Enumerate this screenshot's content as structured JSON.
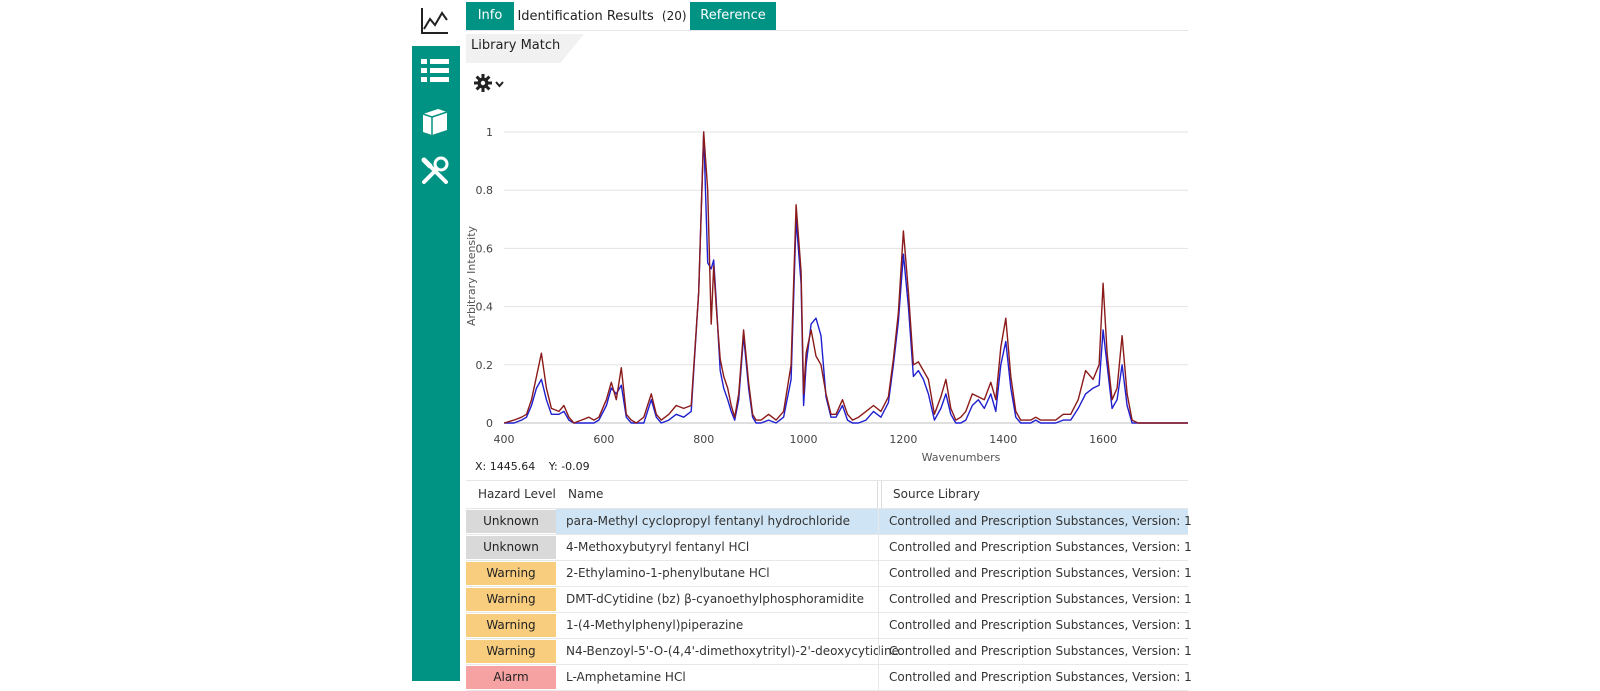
{
  "tabs": [
    {
      "label": "Info",
      "active": false
    },
    {
      "label": "Identification Results",
      "count": "(20)",
      "active": true
    },
    {
      "label": "Reference",
      "active": false
    }
  ],
  "subtab": {
    "label": "Library Match"
  },
  "sidebar": {
    "items": [
      {
        "icon": "spectrum-chart-icon"
      },
      {
        "icon": "list-icon"
      },
      {
        "icon": "book-icon"
      },
      {
        "icon": "tools-icon"
      }
    ]
  },
  "cursor": {
    "x": "X: 1445.64",
    "y": "Y: -0.09"
  },
  "colors": {
    "accent": "#009384",
    "series_blue": "#1f1fd0",
    "series_red": "#8b1a1a",
    "unknown": "#d9d9d9",
    "warning": "#f8cd7e",
    "alarm": "#f7a2a2",
    "selected": "#cfe4f4"
  },
  "table": {
    "headers": {
      "hazard": "Hazard Level",
      "name": "Name",
      "source": "Source Library"
    },
    "rows": [
      {
        "hazard": "Unknown",
        "level": "unknown",
        "name": "para-Methyl cyclopropyl fentanyl hydrochloride",
        "source": "Controlled and Prescription Substances, Version: 1",
        "selected": true
      },
      {
        "hazard": "Unknown",
        "level": "unknown",
        "name": "4-Methoxybutyryl fentanyl HCl",
        "source": "Controlled and Prescription Substances, Version: 1",
        "selected": false
      },
      {
        "hazard": "Warning",
        "level": "warning",
        "name": "2-Ethylamino-1-phenylbutane HCl",
        "source": "Controlled and Prescription Substances, Version: 1",
        "selected": false
      },
      {
        "hazard": "Warning",
        "level": "warning",
        "name": "DMT-dCytidine (bz)  β-cyanoethylphosphoramidite",
        "source": "Controlled and Prescription Substances, Version: 1",
        "selected": false
      },
      {
        "hazard": "Warning",
        "level": "warning",
        "name": "1-(4-Methylphenyl)piperazine",
        "source": "Controlled and Prescription Substances, Version: 1",
        "selected": false
      },
      {
        "hazard": "Warning",
        "level": "warning",
        "name": "N4-Benzoyl-5'-O-(4,4'-dimethoxytrityl)-2'-deoxycytidine",
        "source": "Controlled and Prescription Substances, Version: 1",
        "selected": false
      },
      {
        "hazard": "Alarm",
        "level": "alarm",
        "name": "L-Amphetamine HCl",
        "source": "Controlled and Prescription Substances, Version: 1",
        "selected": false
      }
    ]
  },
  "chart_data": {
    "type": "line",
    "xlabel": "Wavenumbers",
    "ylabel": "Arbitrary Intensity",
    "xlim": [
      400,
      1770
    ],
    "ylim": [
      0,
      1
    ],
    "xticks": [
      400,
      600,
      800,
      1000,
      1200,
      1400,
      1600
    ],
    "yticks": [
      0,
      0.2,
      0.4,
      0.6,
      0.8,
      1
    ],
    "yticklabels": [
      "0",
      "0.2",
      "0.4",
      "0.6",
      "0.8",
      "1"
    ],
    "grid": true,
    "series": [
      {
        "color": "#1f1fd0",
        "x": [
          400,
          420,
          435,
          445,
          455,
          465,
          475,
          485,
          495,
          510,
          520,
          530,
          540,
          555,
          570,
          580,
          590,
          605,
          615,
          625,
          635,
          645,
          655,
          665,
          680,
          695,
          705,
          715,
          730,
          745,
          760,
          775,
          790,
          800,
          808,
          815,
          820,
          825,
          833,
          840,
          848,
          855,
          862,
          870,
          880,
          890,
          898,
          905,
          915,
          930,
          945,
          960,
          975,
          985,
          995,
          1000,
          1005,
          1015,
          1025,
          1035,
          1045,
          1055,
          1065,
          1078,
          1088,
          1098,
          1110,
          1125,
          1140,
          1155,
          1170,
          1180,
          1190,
          1200,
          1210,
          1220,
          1230,
          1240,
          1250,
          1262,
          1275,
          1285,
          1295,
          1305,
          1315,
          1325,
          1338,
          1350,
          1362,
          1375,
          1385,
          1395,
          1405,
          1415,
          1425,
          1435,
          1445,
          1455,
          1465,
          1475,
          1490,
          1505,
          1520,
          1535,
          1550,
          1565,
          1580,
          1592,
          1600,
          1608,
          1618,
          1628,
          1638,
          1648,
          1658,
          1670,
          1690,
          1720,
          1770
        ],
        "y": [
          0,
          0,
          0.01,
          0.02,
          0.06,
          0.12,
          0.15,
          0.08,
          0.03,
          0.03,
          0.04,
          0.01,
          0,
          0,
          0,
          0,
          0.01,
          0.06,
          0.12,
          0.1,
          0.13,
          0.02,
          0,
          0,
          0,
          0.08,
          0.02,
          0,
          0.01,
          0.03,
          0.02,
          0.04,
          0.45,
          1.0,
          0.55,
          0.53,
          0.56,
          0.42,
          0.18,
          0.12,
          0.08,
          0.04,
          0.01,
          0.08,
          0.3,
          0.12,
          0.02,
          0,
          0,
          0.01,
          0,
          0.02,
          0.15,
          0.7,
          0.48,
          0.06,
          0.2,
          0.34,
          0.36,
          0.3,
          0.09,
          0.02,
          0.02,
          0.06,
          0.01,
          0,
          0,
          0.01,
          0.04,
          0.02,
          0.07,
          0.2,
          0.35,
          0.58,
          0.4,
          0.16,
          0.18,
          0.15,
          0.1,
          0.01,
          0.05,
          0.1,
          0.03,
          0,
          0,
          0.01,
          0.06,
          0.08,
          0.05,
          0.1,
          0.04,
          0.2,
          0.28,
          0.12,
          0.02,
          0,
          0,
          0,
          0.01,
          0,
          0,
          0,
          0.01,
          0.01,
          0.05,
          0.1,
          0.12,
          0.13,
          0.32,
          0.2,
          0.05,
          0.08,
          0.2,
          0.06,
          0,
          0,
          0,
          0,
          0
        ]
      },
      {
        "color": "#8b1a1a",
        "x": [
          400,
          420,
          435,
          445,
          455,
          465,
          475,
          485,
          495,
          510,
          520,
          530,
          540,
          555,
          570,
          580,
          590,
          605,
          615,
          625,
          635,
          645,
          655,
          665,
          680,
          695,
          705,
          715,
          730,
          745,
          760,
          775,
          790,
          800,
          808,
          815,
          820,
          825,
          833,
          840,
          848,
          855,
          862,
          870,
          880,
          890,
          898,
          905,
          915,
          930,
          945,
          960,
          975,
          985,
          995,
          1000,
          1005,
          1015,
          1025,
          1035,
          1045,
          1055,
          1065,
          1078,
          1088,
          1098,
          1110,
          1125,
          1140,
          1155,
          1170,
          1180,
          1190,
          1200,
          1210,
          1220,
          1230,
          1240,
          1250,
          1262,
          1275,
          1285,
          1295,
          1305,
          1315,
          1325,
          1338,
          1350,
          1362,
          1375,
          1385,
          1395,
          1405,
          1415,
          1425,
          1435,
          1445,
          1455,
          1465,
          1475,
          1490,
          1505,
          1520,
          1535,
          1550,
          1565,
          1580,
          1592,
          1600,
          1608,
          1618,
          1628,
          1638,
          1648,
          1658,
          1670,
          1690,
          1720,
          1770
        ],
        "y": [
          0,
          0.01,
          0.02,
          0.03,
          0.08,
          0.16,
          0.24,
          0.12,
          0.05,
          0.04,
          0.06,
          0.02,
          0,
          0.01,
          0.02,
          0.01,
          0.02,
          0.08,
          0.14,
          0.08,
          0.19,
          0.03,
          0.01,
          0,
          0.02,
          0.1,
          0.03,
          0.01,
          0.03,
          0.06,
          0.05,
          0.06,
          0.45,
          1.0,
          0.8,
          0.34,
          0.54,
          0.4,
          0.22,
          0.16,
          0.12,
          0.06,
          0.02,
          0.1,
          0.32,
          0.14,
          0.03,
          0.01,
          0.01,
          0.03,
          0.01,
          0.04,
          0.2,
          0.75,
          0.52,
          0.1,
          0.24,
          0.32,
          0.23,
          0.2,
          0.1,
          0.03,
          0.03,
          0.08,
          0.03,
          0.01,
          0.02,
          0.04,
          0.06,
          0.04,
          0.09,
          0.22,
          0.38,
          0.66,
          0.45,
          0.2,
          0.21,
          0.18,
          0.15,
          0.03,
          0.09,
          0.15,
          0.05,
          0.01,
          0.02,
          0.04,
          0.1,
          0.09,
          0.08,
          0.14,
          0.08,
          0.26,
          0.36,
          0.16,
          0.04,
          0.01,
          0.01,
          0.01,
          0.02,
          0.01,
          0.01,
          0.01,
          0.03,
          0.03,
          0.08,
          0.18,
          0.15,
          0.2,
          0.48,
          0.24,
          0.08,
          0.12,
          0.3,
          0.1,
          0.01,
          0,
          0,
          0,
          0
        ]
      }
    ]
  }
}
